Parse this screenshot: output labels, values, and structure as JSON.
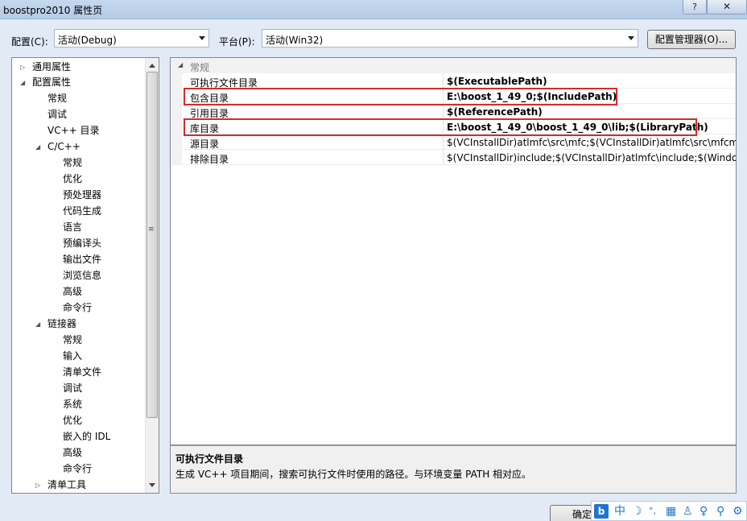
{
  "window": {
    "title": "boostpro2010 属性页",
    "help": "?",
    "close": "✕"
  },
  "toolbar": {
    "config_label": "配置(C):",
    "config_value": "活动(Debug)",
    "platform_label": "平台(P):",
    "platform_value": "活动(Win32)",
    "config_manager": "配置管理器(O)..."
  },
  "tree": {
    "items": [
      {
        "label": "通用属性"
      },
      {
        "label": "配置属性"
      },
      {
        "label": "常规"
      },
      {
        "label": "调试"
      },
      {
        "label": "VC++ 目录"
      },
      {
        "label": "C/C++"
      },
      {
        "label": "常规"
      },
      {
        "label": "优化"
      },
      {
        "label": "预处理器"
      },
      {
        "label": "代码生成"
      },
      {
        "label": "语言"
      },
      {
        "label": "预编译头"
      },
      {
        "label": "输出文件"
      },
      {
        "label": "浏览信息"
      },
      {
        "label": "高级"
      },
      {
        "label": "命令行"
      },
      {
        "label": "链接器"
      },
      {
        "label": "常规"
      },
      {
        "label": "输入"
      },
      {
        "label": "清单文件"
      },
      {
        "label": "调试"
      },
      {
        "label": "系统"
      },
      {
        "label": "优化"
      },
      {
        "label": "嵌入的 IDL"
      },
      {
        "label": "高级"
      },
      {
        "label": "命令行"
      },
      {
        "label": "清单工具"
      }
    ]
  },
  "grid": {
    "section": "常规",
    "rows": [
      {
        "name": "可执行文件目录",
        "value": "$(ExecutablePath)"
      },
      {
        "name": "包含目录",
        "value": "E:\\boost_1_49_0;$(IncludePath)"
      },
      {
        "name": "引用目录",
        "value": "$(ReferencePath)"
      },
      {
        "name": "库目录",
        "value": "E:\\boost_1_49_0\\boost_1_49_0\\lib;$(LibraryPath)"
      },
      {
        "name": "源目录",
        "value": "$(VCInstallDir)atlmfc\\src\\mfc;$(VCInstallDir)atlmfc\\src\\mfcm;$("
      },
      {
        "name": "排除目录",
        "value": "$(VCInstallDir)include;$(VCInstallDir)atlmfc\\include;$(Windows$"
      }
    ]
  },
  "description": {
    "title": "可执行文件目录",
    "text": "生成 VC++ 项目期间，搜索可执行文件时使用的路径。与环境变量 PATH 相对应。"
  },
  "footer": {
    "ok": "确定"
  },
  "ime": {
    "logo": "b",
    "lang": "中"
  },
  "colors": {
    "highlight": "#d62b2b",
    "accent": "#1f74cf"
  }
}
